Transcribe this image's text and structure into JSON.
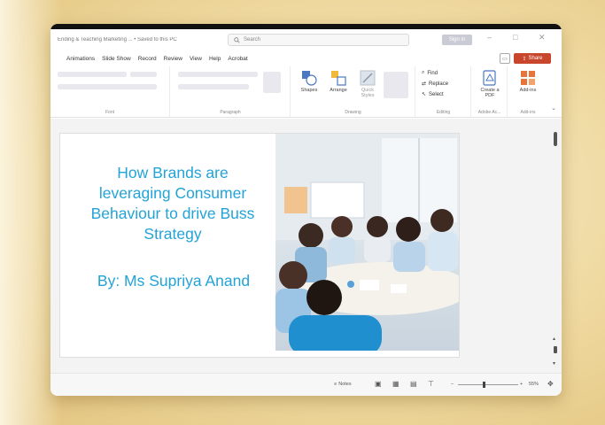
{
  "window": {
    "doc_title": "Ending & Teaching Marketing ... • Saved to this PC",
    "search_placeholder": "Search",
    "profile_label": "Sign in"
  },
  "menu": {
    "tabs": [
      "Animations",
      "Slide Show",
      "Record",
      "Review",
      "View",
      "Help",
      "Acrobat"
    ],
    "share_label": "Share"
  },
  "ribbon": {
    "font_label": "Font",
    "paragraph_label": "Paragraph",
    "drawing_label": "Drawing",
    "editing_label": "Editing",
    "adobe_label": "Adobe Ac...",
    "addins_label": "Add-ins",
    "shapes_label": "Shapes",
    "arrange_label": "Arrange",
    "quick_styles_label": "Quick Styles",
    "find_label": "Find",
    "replace_label": "Replace",
    "select_label": "Select",
    "create_pdf_label": "Create a PDF",
    "addins_btn_label": "Add-ins"
  },
  "slide": {
    "title_lines": [
      "How Brands are",
      "leveraging Consumer",
      "Behaviour to drive Buss",
      "Strategy"
    ],
    "author": "By: Ms Supriya Anand"
  },
  "status": {
    "notes_label": "Notes",
    "zoom_label": "55%"
  },
  "colors": {
    "slide_text": "#23a3d7",
    "share_button": "#c8462c",
    "background": "#f0dca6"
  }
}
